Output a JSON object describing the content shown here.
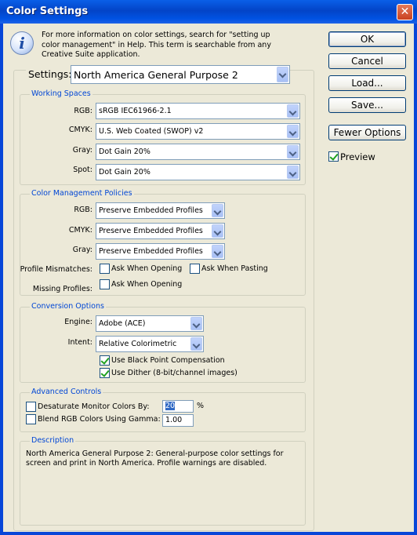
{
  "window": {
    "title": "Color Settings",
    "close_symbol": "✕"
  },
  "info": {
    "icon_glyph": "i",
    "text": "For more information on color settings, search for \"setting up color management\" in Help. This term is searchable from any Creative Suite application."
  },
  "buttons": {
    "ok": "OK",
    "cancel": "Cancel",
    "load": "Load...",
    "save": "Save...",
    "fewer_options": "Fewer Options"
  },
  "preview": {
    "label": "Preview",
    "checked": true
  },
  "settings": {
    "label": "Settings:",
    "value": "North America General Purpose 2"
  },
  "working_spaces": {
    "legend": "Working Spaces",
    "rgb": {
      "label": "RGB:",
      "value": "sRGB IEC61966-2.1"
    },
    "cmyk": {
      "label": "CMYK:",
      "value": "U.S. Web Coated (SWOP) v2"
    },
    "gray": {
      "label": "Gray:",
      "value": "Dot Gain 20%"
    },
    "spot": {
      "label": "Spot:",
      "value": "Dot Gain 20%"
    }
  },
  "policies": {
    "legend": "Color Management Policies",
    "rgb": {
      "label": "RGB:",
      "value": "Preserve Embedded Profiles"
    },
    "cmyk": {
      "label": "CMYK:",
      "value": "Preserve Embedded Profiles"
    },
    "gray": {
      "label": "Gray:",
      "value": "Preserve Embedded Profiles"
    },
    "profile_mismatches": {
      "label": "Profile Mismatches:",
      "ask_opening": "Ask When Opening",
      "ask_pasting": "Ask When Pasting"
    },
    "missing_profiles": {
      "label": "Missing Profiles:",
      "ask_opening": "Ask When Opening"
    }
  },
  "conversion": {
    "legend": "Conversion Options",
    "engine": {
      "label": "Engine:",
      "value": "Adobe (ACE)"
    },
    "intent": {
      "label": "Intent:",
      "value": "Relative Colorimetric"
    },
    "black_point": {
      "label": "Use Black Point Compensation",
      "checked": true
    },
    "dither": {
      "label": "Use Dither (8-bit/channel images)",
      "checked": true
    }
  },
  "advanced": {
    "legend": "Advanced Controls",
    "desaturate": {
      "label": "Desaturate Monitor Colors By:",
      "value": "20",
      "unit": "%"
    },
    "blend": {
      "label": "Blend RGB Colors Using Gamma:",
      "value": "1.00"
    }
  },
  "description": {
    "legend": "Description",
    "text": "North America General Purpose 2:  General-purpose color settings for screen and print in North America. Profile warnings are disabled."
  }
}
